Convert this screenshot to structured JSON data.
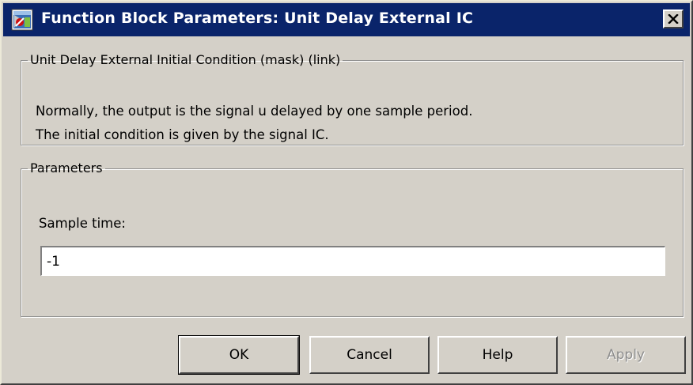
{
  "window": {
    "title": "Function Block Parameters: Unit Delay External IC",
    "title_color": "#0a246a",
    "close_icon": "close-icon"
  },
  "description_group": {
    "legend": "Unit Delay External Initial Condition (mask) (link)",
    "lines": [
      "Normally, the output is the signal u delayed by one sample period.",
      "The initial condition is given by the signal IC."
    ]
  },
  "parameters_group": {
    "legend": "Parameters",
    "sample_time_label": "Sample time:",
    "sample_time_value": "-1"
  },
  "buttons": {
    "ok": "OK",
    "cancel": "Cancel",
    "help": "Help",
    "apply": "Apply"
  }
}
